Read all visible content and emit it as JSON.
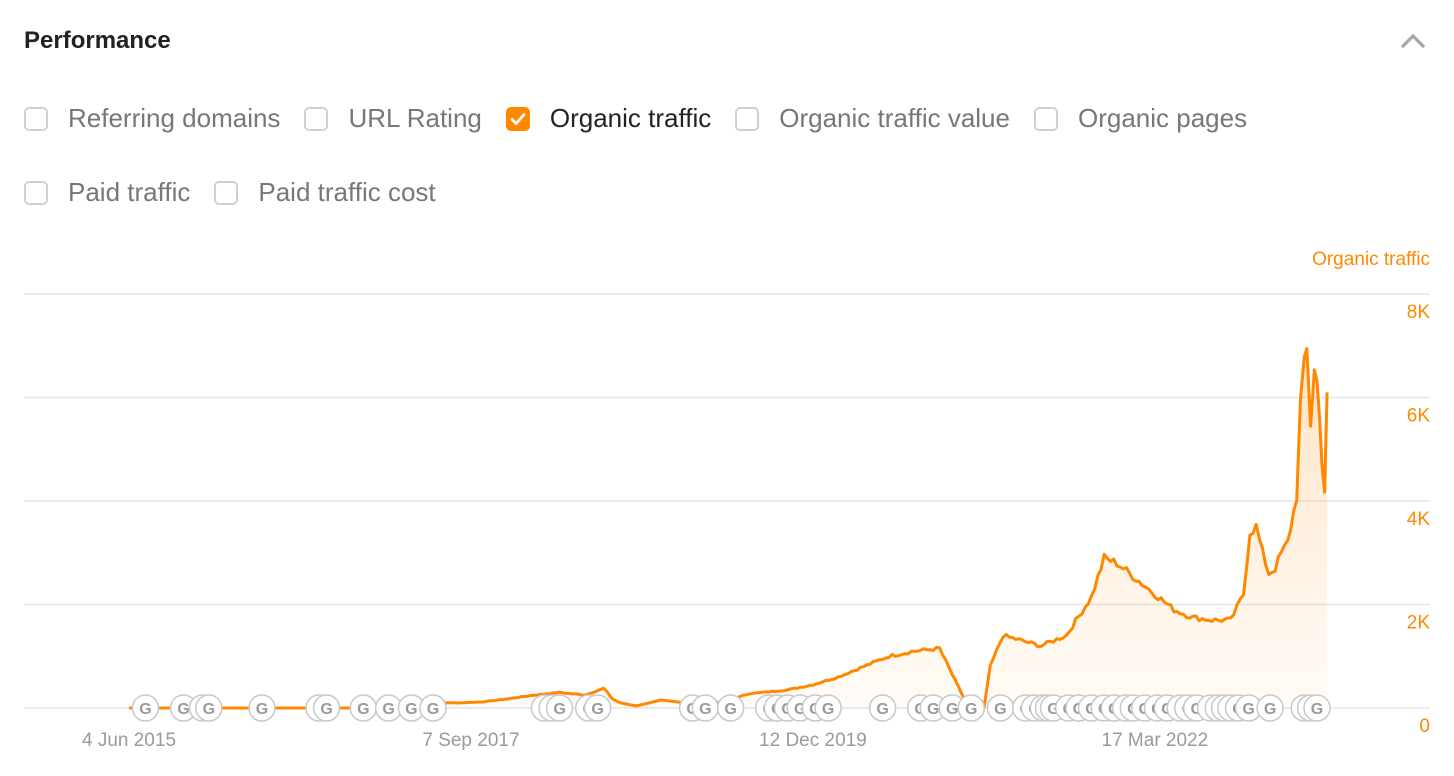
{
  "header": {
    "title": "Performance",
    "collapse_icon": "chevron-up-icon"
  },
  "metrics": [
    {
      "label": "Referring domains",
      "checked": false
    },
    {
      "label": "URL Rating",
      "checked": false
    },
    {
      "label": "Organic traffic",
      "checked": true
    },
    {
      "label": "Organic traffic value",
      "checked": false
    },
    {
      "label": "Organic pages",
      "checked": false
    },
    {
      "label": "Paid traffic",
      "checked": false
    },
    {
      "label": "Paid traffic cost",
      "checked": false
    }
  ],
  "colors": {
    "accent": "#ff8800",
    "grid": "#e6e6e6",
    "tick": "#9a9a9a",
    "marker": "#c8c8c8"
  },
  "chart_data": {
    "type": "area",
    "title": "",
    "series_label": "Organic traffic",
    "xlabel": "",
    "ylabel": "Organic traffic",
    "ylim": [
      0,
      8000
    ],
    "yticks": [
      0,
      2000,
      4000,
      6000,
      8000
    ],
    "ytick_labels": [
      "0",
      "2K",
      "4K",
      "6K",
      "8K"
    ],
    "y_axis_position": "right",
    "xticks": [
      0,
      27,
      54,
      81
    ],
    "xtick_labels": [
      "4 Jun 2015",
      "7 Sep 2017",
      "12 Dec 2019",
      "17 Mar 2022"
    ],
    "x_unit": "months since 4 Jun 2015",
    "xlim": [
      0,
      95
    ],
    "grid": true,
    "series": [
      {
        "name": "Organic traffic",
        "x": [
          0,
          5,
          10,
          15,
          20,
          23,
          24,
          26,
          28,
          30,
          32,
          34,
          36,
          37.5,
          38.2,
          38.8,
          40,
          42,
          45,
          47,
          49,
          50,
          52,
          54,
          56,
          58,
          60,
          62,
          64,
          66,
          67.5,
          68,
          69,
          70.5,
          72,
          74,
          76,
          77,
          78,
          78.5,
          79.5,
          81,
          82.5,
          84,
          85.5,
          87,
          88,
          88.5,
          89,
          89.5,
          90,
          90.5,
          91,
          91.5,
          92.2,
          92.5,
          92.8,
          93,
          93.3,
          93.6,
          93.8,
          94,
          94.2,
          94.4,
          94.6
        ],
        "values": [
          0,
          0,
          0,
          0,
          0,
          60,
          100,
          100,
          120,
          180,
          250,
          300,
          250,
          380,
          170,
          100,
          40,
          150,
          80,
          120,
          280,
          300,
          350,
          450,
          600,
          800,
          1000,
          1100,
          1150,
          150,
          0,
          800,
          1400,
          1300,
          1200,
          1400,
          2150,
          2900,
          2800,
          2700,
          2500,
          2200,
          1900,
          1750,
          1700,
          1700,
          2200,
          3400,
          3500,
          3000,
          2600,
          2700,
          3000,
          3200,
          4100,
          5900,
          6600,
          6900,
          5500,
          6600,
          6300,
          5600,
          4800,
          4200,
          6100
        ]
      }
    ],
    "annotations": {
      "type": "google-update-markers",
      "label": "G",
      "x": [
        1.3,
        4.3,
        5.8,
        6.3,
        10.5,
        15.0,
        15.6,
        18.5,
        20.5,
        22.3,
        24.0,
        32.8,
        33.4,
        34.0,
        36.3,
        37.0,
        44.5,
        45.5,
        47.5,
        50.5,
        51.2,
        52.0,
        53.0,
        54.2,
        55.2,
        59.5,
        62.5,
        63.5,
        65.0,
        66.5,
        68.8,
        70.8,
        71.5,
        72.2,
        72.6,
        73.0,
        74.2,
        75.0,
        76.0,
        77.0,
        77.8,
        78.7,
        79.3,
        80.2,
        81.2,
        82.0,
        83.0,
        83.6,
        84.3,
        85.4,
        86.0,
        86.5,
        87.0,
        87.6,
        88.4,
        90.1,
        92.8,
        93.3,
        93.8
      ]
    }
  }
}
